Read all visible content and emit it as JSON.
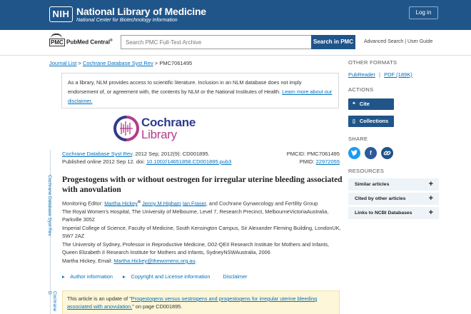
{
  "header": {
    "logo_text": "NIH",
    "title": "National Library of Medicine",
    "subtitle": "National Center for Biotechnology Information",
    "login_label": "Log in"
  },
  "search": {
    "logo_prefix": "PMC",
    "logo_name": "PubMed Central",
    "logo_mark": "®",
    "placeholder": "Search PMC Full-Text Archive",
    "button_label": "Search in PMC",
    "advanced_label": "Advanced Search",
    "separator": "|",
    "guide_label": "User Guide"
  },
  "breadcrumb": {
    "items": [
      "Journal List",
      "Cochrane Database Syst Rev",
      "PMC7061495"
    ],
    "separator": ">"
  },
  "notice": {
    "text": "As a library, NLM provides access to scientific literature. Inclusion in an NLM database does not imply endorsement of, or agreement with, the contents by NLM or the National Institutes of Health.",
    "link": "Learn more about our disclaimer."
  },
  "journal_logo": {
    "line1": "Cochrane",
    "line2": "Library"
  },
  "side_label": "Cochrane Database Syst Rev",
  "side_label2": "Cochrane D",
  "citation": {
    "journal_link": "Cochrane Database Syst Rev",
    "volume": ". 2012 Sep; 2012(9): CD001895.",
    "published_prefix": "Published online 2012 Sep 12. doi: ",
    "doi": "10.1002/14651858.CD001895.pub3",
    "pmcid_label": "PMCID: PMC7061495",
    "pmid_prefix": "PMID: ",
    "pmid": "22972055"
  },
  "article": {
    "title": "Progestogens with or without oestrogen for irregular uterine bleeding associated with anovulation",
    "editor_prefix": "Monitoring Editor: ",
    "author1": "Martha Hickey",
    "author1_sup": "⊠",
    "author2": "Jenny M Higham",
    "author3": "Ian Fraser",
    "group": ", and Cochrane Gynaecology and Fertility Group",
    "aff1": "The Royal Women's Hospital, The University of Melbourne, Level 7, Research Precinct, MelbourneVictoriaAustralia, Parkville 3052",
    "aff2": "Imperial College of Science, Faculty of Medicine, South Kensington Campus, Sir Alexander Fleming Building, LondonUK, SW7 2AZ",
    "aff3": "The University of Sydney, Professor in Reproductive Medicine, D02-QEII Research Institute for Mothers and Infants, Queen Elizabeth II Research Institute for Mothers and Infants, SydneyNSWAustralia, 2006",
    "email_prefix": "Martha Hickey, Email: ",
    "email": "Martha.Hickey@thewomens.org.au",
    "email_suffix": "."
  },
  "info_links": {
    "author_info": "Author information",
    "copyright": "Copyright and License information",
    "disclaimer": "Disclaimer"
  },
  "update_notice": {
    "prefix": "This article is an update of \"",
    "link": "Progestogens versus oestrogens and progestogens for irregular uterine bleeding associated with anovulation.",
    "suffix": "\" on page CD001895."
  },
  "sidebar": {
    "other_formats_heading": "OTHER FORMATS",
    "pubreader": "PubReader",
    "format_separator": "|",
    "pdf": "PDF (189K)",
    "actions_heading": "ACTIONS",
    "cite_label": "Cite",
    "collections_label": "Collections",
    "share_heading": "SHARE",
    "resources_heading": "RESOURCES",
    "resources": [
      "Similar articles",
      "Cited by other articles",
      "Links to NCBI Databases"
    ]
  },
  "colors": {
    "brand_blue": "#20558a",
    "link_blue": "#0071bc",
    "twitter": "#1d9bf0",
    "facebook": "#2d5a9b",
    "link_share": "#20558a"
  }
}
